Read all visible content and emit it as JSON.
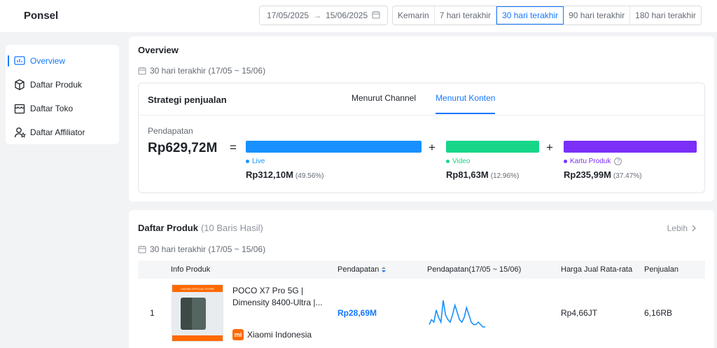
{
  "header": {
    "title": "Ponsel",
    "date_start": "17/05/2025",
    "date_end": "15/06/2025",
    "periods": [
      "Kemarin",
      "7 hari terakhir",
      "30 hari terakhir",
      "90 hari terakhir",
      "180 hari terakhir"
    ],
    "active_period": "30 hari terakhir"
  },
  "sidebar": {
    "items": [
      {
        "label": "Overview",
        "icon": "chart-icon",
        "active": true
      },
      {
        "label": "Daftar Produk",
        "icon": "box-icon",
        "active": false
      },
      {
        "label": "Daftar Toko",
        "icon": "store-icon",
        "active": false
      },
      {
        "label": "Daftar Affiliator",
        "icon": "user-star-icon",
        "active": false
      }
    ]
  },
  "overview": {
    "title": "Overview",
    "date_note": "30 hari terakhir (17/05 ~ 15/06)",
    "strategy": {
      "title": "Strategi penjualan",
      "tabs": [
        "Menurut Channel",
        "Menurut Konten"
      ],
      "active_tab": "Menurut Konten",
      "revenue_label": "Pendapatan",
      "total": "Rp629,72M",
      "eq": "=",
      "plus": "+",
      "segments": [
        {
          "name": "Live",
          "value": "Rp312,10M",
          "pct": "(49.56%)",
          "color": "#1890ff"
        },
        {
          "name": "Video",
          "value": "Rp81,63M",
          "pct": "(12.96%)",
          "color": "#17d68a"
        },
        {
          "name": "Kartu Produk",
          "value": "Rp235,99M",
          "pct": "(37.47%)",
          "color": "#7b2ff7"
        }
      ]
    }
  },
  "products": {
    "title": "Daftar Produk",
    "count": "(10 Baris Hasil)",
    "more": "Lebih",
    "date_note": "30 hari terakhir (17/05 ~ 15/06)",
    "columns": [
      "Info Produk",
      "Pendapatan",
      "Pendapatan(17/05 ~ 15/06)",
      "Harga Jual Rata-rata",
      "Penjualan"
    ],
    "rows": [
      {
        "rank": "1",
        "name": "POCO X7 Pro 5G | Dimensity 8400-Ultra |...",
        "shop": "Xiaomi Indonesia",
        "shop_icon": "mi",
        "thumb_banner": "XIAOMI OFFICIAL STORE",
        "revenue": "Rp28,69M",
        "avg_price": "Rp4,66JT",
        "sales": "6,16RB",
        "trend": [
          2,
          4,
          3,
          8,
          5,
          3,
          12,
          6,
          4,
          3,
          6,
          10,
          7,
          4,
          3,
          5,
          9,
          6,
          3,
          2,
          2,
          3,
          2,
          1,
          1
        ]
      }
    ]
  },
  "colors": {
    "accent": "#1677ff"
  }
}
